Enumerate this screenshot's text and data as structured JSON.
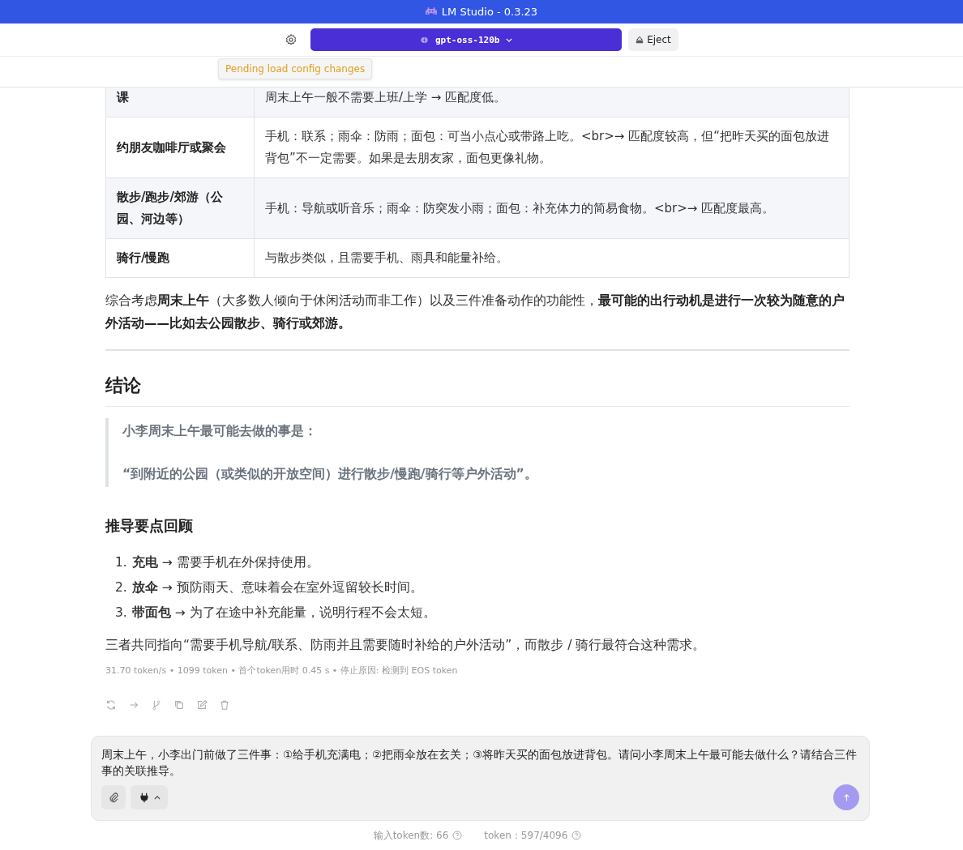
{
  "window": {
    "title": "LM Studio - 0.3.23"
  },
  "toolbar": {
    "model": "gpt-oss-120b",
    "eject": "Eject",
    "tooltip": "Pending load config changes"
  },
  "table": {
    "rows": [
      {
        "scene": "课",
        "analysis": "周末上午一般不需要上班/上学 → 匹配度低。"
      },
      {
        "scene": "约朋友咖啡厅或聚会",
        "analysis": "手机：联系；雨伞：防雨；面包：可当小点心或带路上吃。<br>→ 匹配度较高，但“把昨天买的面包放进背包”不一定需要。如果是去朋友家，面包更像礼物。"
      },
      {
        "scene": "散步/跑步/郊游（公园、河边等）",
        "analysis": "手机：导航或听音乐；雨伞：防突发小雨；面包：补充体力的简易食物。<br>→ 匹配度最高。"
      },
      {
        "scene": "骑行/慢跑",
        "analysis": "与散步类似，且需要手机、雨具和能量补给。"
      }
    ]
  },
  "summary": "综合考虑**周末上午**（大多数人倾向于休闲活动而非工作）以及三件准备动作的功能性，**最可能的出行动机是进行一次较为随意的户外活动——比如去公园散步、骑行或郊游。**",
  "conclusion": {
    "heading": "结论",
    "quote": [
      "小李周末上午最可能去做的事是：",
      "“到附近的公园（或类似的开放空间）进行散步/慢跑/骑行等户外活动”。"
    ]
  },
  "review": {
    "heading": "推导要点回顾",
    "items": [
      {
        "number": "1.",
        "text": "**充电** → 需要手机在外保持使用。"
      },
      {
        "number": "2.",
        "text": "**放伞** → 预防雨天、意味着会在室外逗留较长时间。"
      },
      {
        "number": "3.",
        "text": "**带面包** → 为了在途中补充能量，说明行程不会太短。"
      }
    ]
  },
  "closing": "三者共同指向“需要手机导航/联系、防雨并且需要随时补给的户外活动”，而散步 / 骑行最符合这种需求。",
  "stats": "31.70 token/s • 1099 token • 首个token用时 0.45 s • 停止原因: 检测到 EOS token",
  "input": {
    "value": "周末上午，小李出门前做了三件事：①给手机充满电；②把雨伞放在玄关；③将昨天买的面包放进背包。请问小李周末上午最可能去做什么？请结合三件事的关联推导。"
  },
  "footer": {
    "input_tokens": "输入token数: 66",
    "tokens": "token：597/4096"
  }
}
